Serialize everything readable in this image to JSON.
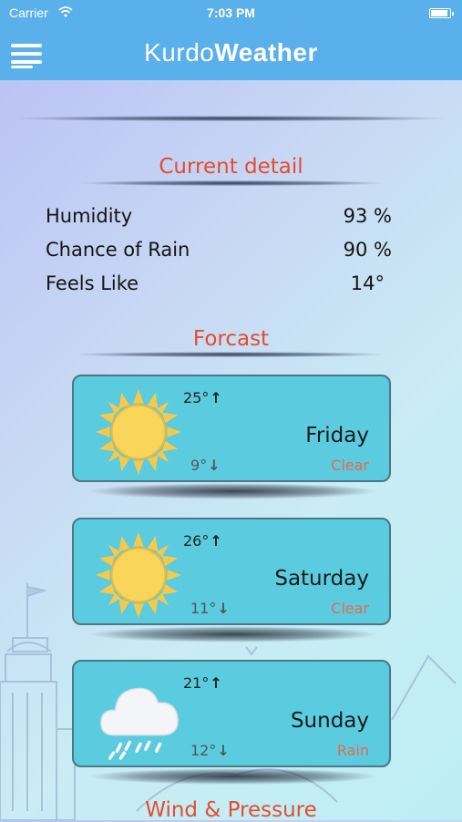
{
  "status_bar": {
    "carrier": "Carrier",
    "time": "7:03 PM"
  },
  "navbar": {
    "title_part1": "Kurdo",
    "title_part2": "Weather",
    "menu_icon": "hamburger-menu-icon"
  },
  "current_detail": {
    "title": "Current detail",
    "rows": [
      {
        "label": "Humidity",
        "value": "93 %"
      },
      {
        "label": "Chance of Rain",
        "value": "90 %"
      },
      {
        "label": "Feels Like",
        "value": "14°"
      }
    ]
  },
  "forecast": {
    "title": "Forcast",
    "days": [
      {
        "day": "Friday",
        "high": "25°",
        "low": "9°",
        "condition": "Clear",
        "icon": "sun-icon"
      },
      {
        "day": "Saturday",
        "high": "26°",
        "low": "11°",
        "condition": "Clear",
        "icon": "sun-icon"
      },
      {
        "day": "Sunday",
        "high": "21°",
        "low": "12°",
        "condition": "Rain",
        "icon": "rain-cloud-icon"
      }
    ]
  },
  "wind_pressure": {
    "title": "Wind & Pressure"
  },
  "colors": {
    "bar_blue": "#5ab0ea",
    "accent_red": "#e64c2e",
    "card_cyan": "#5bcbe0",
    "sun_yellow": "#f6c94a"
  }
}
